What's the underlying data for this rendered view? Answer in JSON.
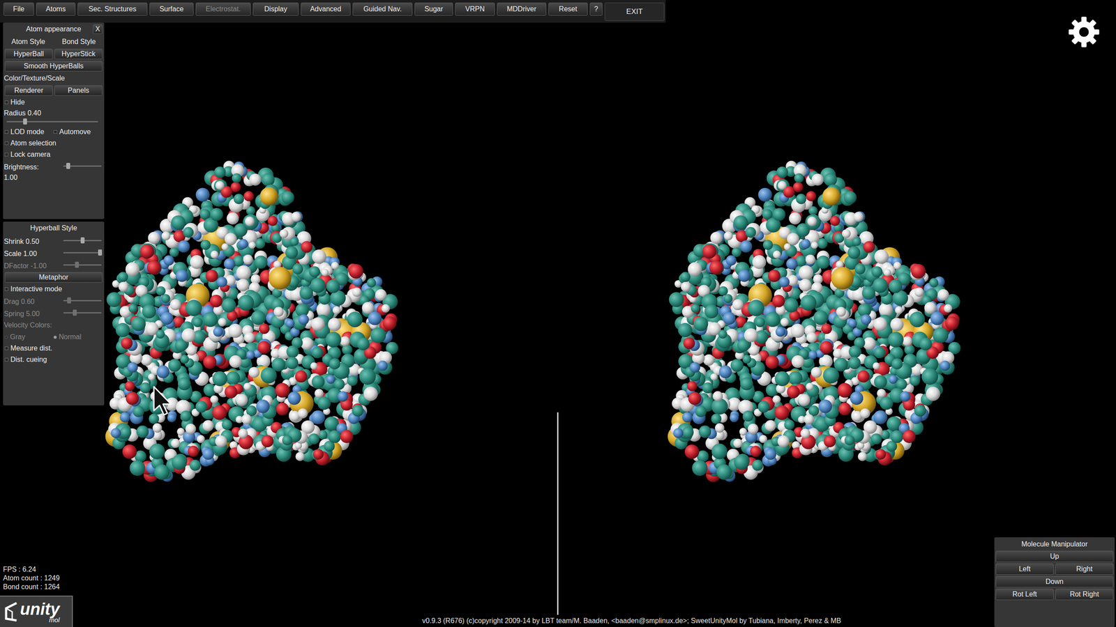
{
  "menu_bar": {
    "items": [
      {
        "label": "File",
        "disabled": false
      },
      {
        "label": "Atoms",
        "disabled": false
      },
      {
        "label": "Sec. Structures",
        "disabled": false
      },
      {
        "label": "Surface",
        "disabled": false
      },
      {
        "label": "Electrostat.",
        "disabled": true
      },
      {
        "label": "Display",
        "disabled": false
      },
      {
        "label": "Advanced",
        "disabled": false
      },
      {
        "label": "Guided Nav.",
        "disabled": false
      },
      {
        "label": "Sugar",
        "disabled": false
      },
      {
        "label": "VRPN",
        "disabled": false
      },
      {
        "label": "MDDriver",
        "disabled": false
      },
      {
        "label": "Reset",
        "disabled": false
      }
    ],
    "help": "?",
    "exit": "EXIT"
  },
  "atom_panel": {
    "title": "Atom appearance",
    "close": "X",
    "rows": [
      {
        "kind": "labels",
        "items": [
          "Atom Style",
          "Bond Style"
        ]
      },
      {
        "kind": "buttons",
        "items": [
          "HyperBall",
          "HyperStick"
        ]
      },
      {
        "kind": "buttons",
        "items": [
          "Smooth HyperBalls"
        ]
      },
      {
        "kind": "label",
        "text": "Color/Texture/Scale",
        "disabled": false
      },
      {
        "kind": "buttons",
        "items": [
          "Renderer",
          "Panels"
        ]
      },
      {
        "kind": "checks",
        "items": [
          {
            "label": "Hide",
            "checked": false
          }
        ]
      },
      {
        "kind": "slider",
        "label": "Radius 0.40",
        "level": 0.2,
        "disabled": false
      },
      {
        "kind": "checks",
        "items": [
          {
            "label": "LOD mode",
            "checked": false
          },
          {
            "label": "Automove",
            "checked": false
          }
        ]
      },
      {
        "kind": "checks",
        "items": [
          {
            "label": "Atom selection",
            "checked": false
          }
        ]
      },
      {
        "kind": "checks",
        "items": [
          {
            "label": "Lock camera",
            "checked": false
          }
        ]
      },
      {
        "kind": "inline_slider",
        "label": "Brightness:",
        "value": "1.00",
        "level": 0.12,
        "disabled": false
      }
    ]
  },
  "hyperball_panel": {
    "title": "Hyperball Style",
    "rows": [
      {
        "kind": "inline_slider",
        "label": "Shrink 0.50",
        "level": 0.5,
        "disabled": false
      },
      {
        "kind": "inline_slider",
        "label": "Scale 1.00",
        "level": 0.95,
        "disabled": false
      },
      {
        "kind": "inline_slider",
        "label": "DFactor -1.00",
        "level": 0.35,
        "disabled": true
      },
      {
        "kind": "buttons",
        "items": [
          "Metaphor"
        ]
      },
      {
        "kind": "checks",
        "items": [
          {
            "label": "Interactive mode",
            "checked": false
          }
        ]
      },
      {
        "kind": "inline_slider",
        "label": "Drag 0.60",
        "level": 0.15,
        "disabled": true
      },
      {
        "kind": "inline_slider",
        "label": "Spring 5.00",
        "level": 0.3,
        "disabled": true
      },
      {
        "kind": "label",
        "text": "Velocity Colors:",
        "disabled": true
      },
      {
        "kind": "radios",
        "disabled": true,
        "items": [
          {
            "label": "Gray",
            "selected": false
          },
          {
            "label": "Normal",
            "selected": true
          }
        ]
      },
      {
        "kind": "checks",
        "items": [
          {
            "label": "Measure dist.",
            "checked": false
          }
        ]
      },
      {
        "kind": "checks",
        "items": [
          {
            "label": "Dist. cueing",
            "checked": false
          }
        ]
      }
    ]
  },
  "stats": [
    "FPS : 6.24",
    "Atom count : 1249",
    "Bond count : 1264"
  ],
  "logo": {
    "main": "unity",
    "sub": "mol"
  },
  "footer": "v0.9.3 (R676) (c)copyright 2009-14 by LBT team/M. Baaden, <baaden@smplinux.de>; SweetUnityMol by Tubiana, Imberty, Perez & MB",
  "manipulator": {
    "title": "Molecule Manipulator",
    "rows": [
      [
        "Up"
      ],
      [
        "Left",
        "Right"
      ],
      [
        "Down"
      ],
      [
        "Rot Left",
        "Rot Right"
      ]
    ]
  }
}
